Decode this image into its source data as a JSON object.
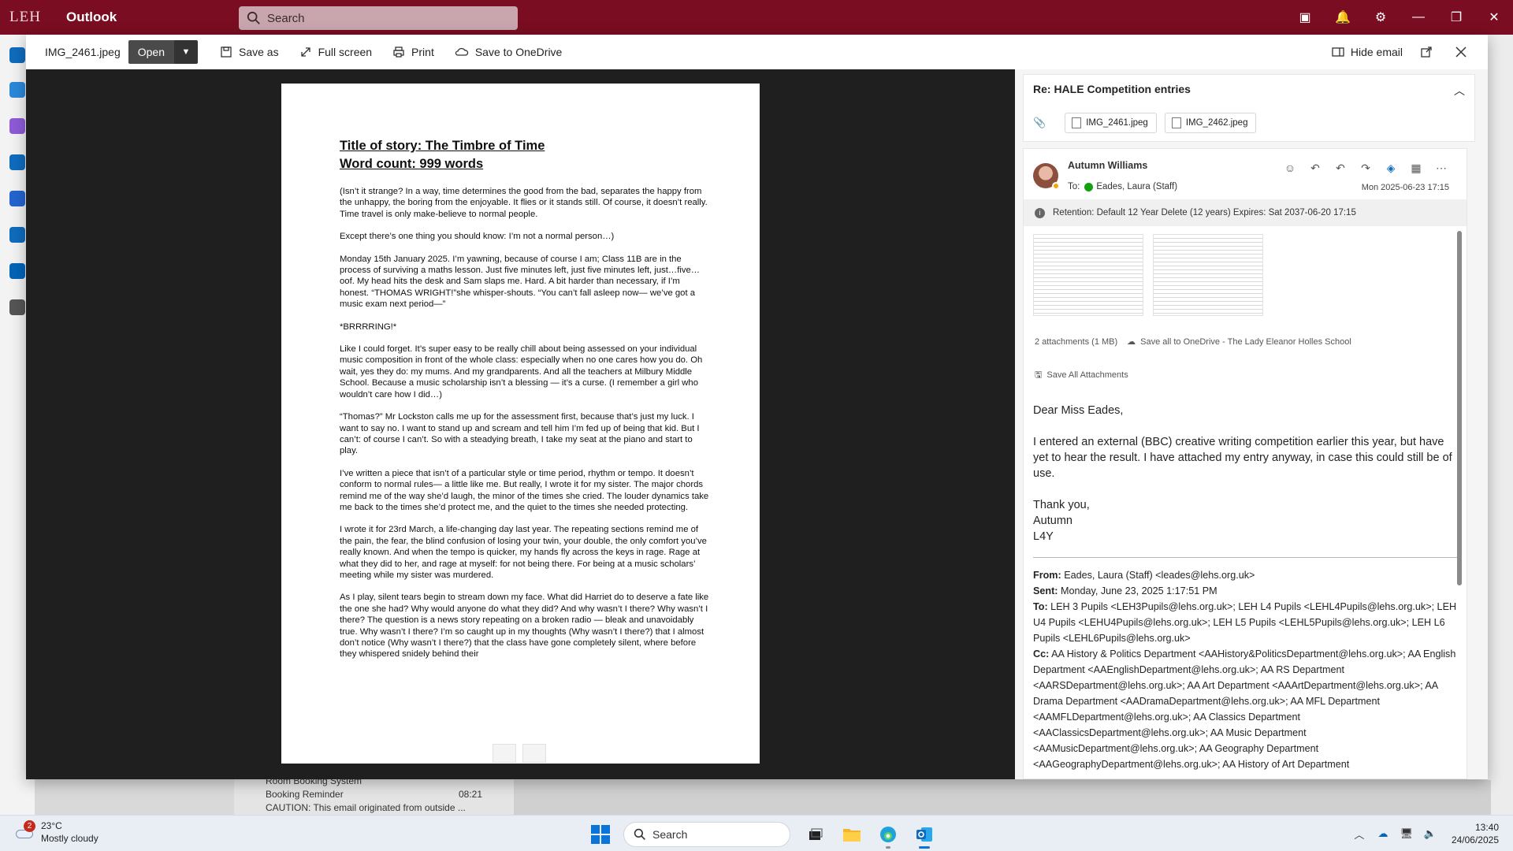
{
  "outlook": {
    "logo_text": "LEH",
    "app_name": "Outlook",
    "search_placeholder": "Search"
  },
  "background": {
    "list_title": "Room Booking System",
    "list_subject": "Booking Reminder",
    "list_time": "08:21",
    "list_preview": "CAUTION: This email originated from outside ..."
  },
  "viewer": {
    "file_name": "IMG_2461.jpeg",
    "open_label": "Open",
    "save_as_label": "Save as",
    "full_screen_label": "Full screen",
    "print_label": "Print",
    "save_onedrive_label": "Save to OneDrive",
    "hide_email_label": "Hide email"
  },
  "document": {
    "title_line1": "Title of story: The Timbre of Time",
    "title_line2": "Word count: 999 words",
    "paragraphs": [
      "(Isn’t it strange? In a way, time determines the good from the bad, separates the happy from the unhappy, the boring from the enjoyable. It flies or it stands still. Of course, it doesn’t really. Time travel is only make-believe to normal people.",
      "Except there’s one thing you should know: I’m not a normal person…)",
      "Monday 15th January 2025. I’m yawning, because of course I am; Class 11B are in the process of surviving a maths lesson. Just five minutes left, just five minutes left, just…five… oof. My head hits the desk and Sam slaps me. Hard. A bit harder than necessary, if I’m honest. “THOMAS WRIGHT!”she whisper-shouts. “You can’t fall asleep now— we’ve got a music exam next period—”",
      "*BRRRRING!*",
      "Like I could forget. It’s super easy to be really chill about being assessed on your individual music composition in front of the whole class: especially when no one cares how you do. Oh wait, yes they do: my mums. And my grandparents. And all the teachers at Milbury Middle School. Because a music scholarship isn’t a blessing — it’s a curse. (I remember a girl who wouldn’t care how I did…)",
      "“Thomas?” Mr Lockston calls me up for the assessment first, because that’s just my luck. I want to say no. I want to stand up and scream and tell him I’m fed up of being that kid. But I can’t: of course I can’t. So with a steadying breath, I take my seat at the piano and start to play.",
      "I’ve written a piece that isn’t of a particular style or time period, rhythm or tempo. It doesn’t conform to normal rules— a little like me. But really, I wrote it for my sister. The major chords remind me of the way she’d laugh, the minor of the times she cried. The louder dynamics take me back to the times she’d protect me, and the quiet to the times she needed protecting.",
      "I wrote it for 23rd March, a life-changing day last year. The repeating sections remind me of the pain, the fear, the blind confusion of losing your twin, your double, the only comfort you’ve really known. And when the tempo is quicker, my hands fly across the keys in rage. Rage at what they did to her, and rage at myself: for not being there. For being at a music scholars’ meeting while my sister was murdered.",
      "As I play, silent tears begin to stream down my face. What did Harriet do to deserve a fate like the one she had? Why would anyone do what they did? And why wasn’t I there? Why wasn’t I there? The question is a news story repeating on a broken radio — bleak and unavoidably true. Why wasn’t I there? I’m so caught up in my thoughts (Why wasn’t I there?) that I almost don’t notice (Why wasn’t I there?) that the class have gone completely silent, where before they whispered snidely behind their"
    ]
  },
  "email": {
    "subject": "Re: HALE Competition entries",
    "attachments": [
      "IMG_2461.jpeg",
      "IMG_2462.jpeg"
    ],
    "sender": "Autumn Williams",
    "to_label": "To:",
    "to_name": "Eades, Laura (Staff)",
    "date": "Mon 2025-06-23 17:15",
    "retention": "Retention: Default 12 Year Delete (12 years) Expires: Sat 2037-06-20 17:15",
    "attachments_summary": "2 attachments (1 MB)",
    "save_all_onedrive": "Save all to OneDrive - The Lady Eleanor Holles School",
    "save_all_attachments": "Save All Attachments",
    "greeting": "Dear Miss Eades,",
    "body": "I entered an external (BBC) creative writing competition earlier this year, but have yet to hear the result. I have attached my entry anyway, in case this could still be of use.",
    "signoff1": "Thank you,",
    "signoff2": "Autumn",
    "signoff3": "L4Y",
    "from_label": "From:",
    "from_value": "Eades, Laura (Staff) <leades@lehs.org.uk>",
    "sent_label": "Sent:",
    "sent_value": "Monday, June 23, 2025 1:17:51 PM",
    "hdr_to_label": "To:",
    "hdr_to_value": "LEH 3 Pupils <LEH3Pupils@lehs.org.uk>; LEH L4 Pupils <LEHL4Pupils@lehs.org.uk>; LEH U4 Pupils <LEHU4Pupils@lehs.org.uk>; LEH L5 Pupils <LEHL5Pupils@lehs.org.uk>; LEH L6 Pupils <LEHL6Pupils@lehs.org.uk>",
    "cc_label": "Cc:",
    "cc_value": "AA History & Politics Department <AAHistory&PoliticsDepartment@lehs.org.uk>; AA English Department <AAEnglishDepartment@lehs.org.uk>; AA RS Department <AARSDepartment@lehs.org.uk>; AA Art Department <AAArtDepartment@lehs.org.uk>; AA Drama Department <AADramaDepartment@lehs.org.uk>; AA MFL Department <AAMFLDepartment@lehs.org.uk>; AA Classics Department <AAClassicsDepartment@lehs.org.uk>; AA Music Department <AAMusicDepartment@lehs.org.uk>; AA Geography Department <AAGeographyDepartment@lehs.org.uk>; AA History of Art Department"
  },
  "taskbar": {
    "weather_badge": "2",
    "temperature": "23°C",
    "weather_desc": "Mostly cloudy",
    "search_label": "Search",
    "time": "13:40",
    "date": "24/06/2025"
  },
  "colors": {
    "outlook_header": "#7a0d22",
    "viewer_stage": "#1f1f1f",
    "accent": "#0a74da"
  }
}
